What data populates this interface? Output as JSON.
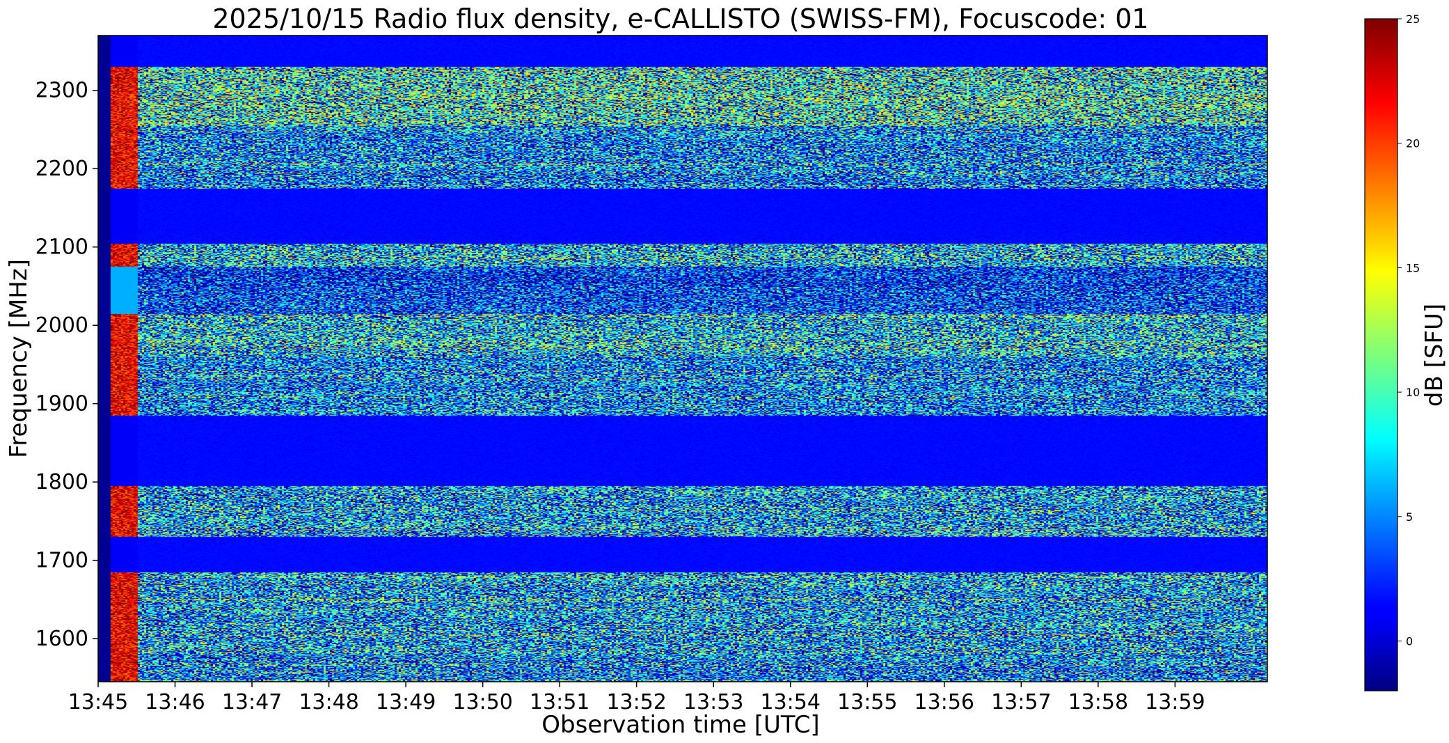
{
  "chart_data": {
    "type": "heatmap",
    "title": "2025/10/15  Radio flux density, e-CALLISTO (SWISS-FM), Focuscode: 01",
    "xlabel": "Observation time [UTC]",
    "ylabel": "Frequency [MHz]",
    "xlim_minutes": [
      0,
      15.2
    ],
    "ylim": [
      1545,
      2370
    ],
    "x_ticks": [
      {
        "label": "13:45",
        "minute": 0
      },
      {
        "label": "13:46",
        "minute": 1
      },
      {
        "label": "13:47",
        "minute": 2
      },
      {
        "label": "13:48",
        "minute": 3
      },
      {
        "label": "13:49",
        "minute": 4
      },
      {
        "label": "13:50",
        "minute": 5
      },
      {
        "label": "13:51",
        "minute": 6
      },
      {
        "label": "13:52",
        "minute": 7
      },
      {
        "label": "13:53",
        "minute": 8
      },
      {
        "label": "13:54",
        "minute": 9
      },
      {
        "label": "13:55",
        "minute": 10
      },
      {
        "label": "13:56",
        "minute": 11
      },
      {
        "label": "13:57",
        "minute": 12
      },
      {
        "label": "13:58",
        "minute": 13
      },
      {
        "label": "13:59",
        "minute": 14
      }
    ],
    "y_ticks": [
      "1600",
      "1700",
      "1800",
      "1900",
      "2000",
      "2100",
      "2200",
      "2300"
    ],
    "colorbar": {
      "label": "dB [SFU]",
      "vmin": -2,
      "vmax": 25,
      "ticks": [
        "0",
        "5",
        "10",
        "15",
        "20",
        "25"
      ],
      "colormap": "jet"
    },
    "bands": [
      {
        "fmin": 1545,
        "fmax": 1580,
        "level": 7
      },
      {
        "fmin": 1580,
        "fmax": 1685,
        "level": 8
      },
      {
        "fmin": 1685,
        "fmax": 1730,
        "level": 1.5
      },
      {
        "fmin": 1730,
        "fmax": 1795,
        "level": 8
      },
      {
        "fmin": 1795,
        "fmax": 1885,
        "level": 1.5
      },
      {
        "fmin": 1885,
        "fmax": 1960,
        "level": 7
      },
      {
        "fmin": 1960,
        "fmax": 2015,
        "level": 9
      },
      {
        "fmin": 2015,
        "fmax": 2050,
        "level": 5
      },
      {
        "fmin": 2050,
        "fmax": 2075,
        "level": 4
      },
      {
        "fmin": 2075,
        "fmax": 2105,
        "level": 9
      },
      {
        "fmin": 2105,
        "fmax": 2175,
        "level": 1.5
      },
      {
        "fmin": 2175,
        "fmax": 2255,
        "level": 7
      },
      {
        "fmin": 2255,
        "fmax": 2330,
        "level": 11
      },
      {
        "fmin": 2330,
        "fmax": 2370,
        "level": 1.5
      }
    ],
    "gap_minutes": [
      0,
      0.5
    ],
    "burst_minutes": [
      0.15,
      0.5
    ]
  }
}
